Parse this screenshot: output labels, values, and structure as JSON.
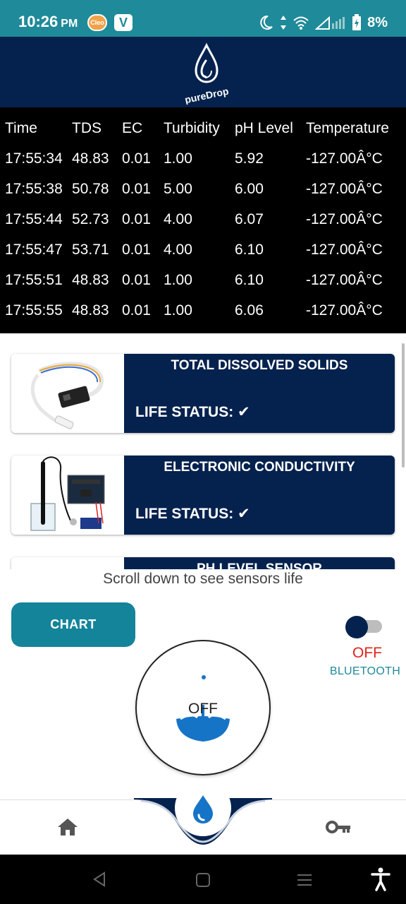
{
  "status_bar": {
    "time": "10:26",
    "ampm": "PM",
    "battery": "8%",
    "app_icon_1": "cleo-app-icon",
    "app_icon_2": "v-app-icon"
  },
  "header": {
    "logo_text": "pureDrop"
  },
  "table": {
    "headers": [
      "Time",
      "TDS",
      "EC",
      "Turbidity",
      "pH Level",
      "Temperature"
    ],
    "rows": [
      [
        "17:55:34",
        "48.83",
        "0.01",
        "1.00",
        "5.92",
        "-127.00Â°C"
      ],
      [
        "17:55:38",
        "50.78",
        "0.01",
        "5.00",
        "6.00",
        "-127.00Â°C"
      ],
      [
        "17:55:44",
        "52.73",
        "0.01",
        "4.00",
        "6.07",
        "-127.00Â°C"
      ],
      [
        "17:55:47",
        "53.71",
        "0.01",
        "4.00",
        "6.10",
        "-127.00Â°C"
      ],
      [
        "17:55:51",
        "48.83",
        "0.01",
        "1.00",
        "6.10",
        "-127.00Â°C"
      ],
      [
        "17:55:55",
        "48.83",
        "0.01",
        "1.00",
        "6.06",
        "-127.00Â°C"
      ]
    ]
  },
  "sensors": [
    {
      "title": "TOTAL DISSOLVED SOLIDS",
      "status": "LIFE STATUS: ✔"
    },
    {
      "title": "ELECTRONIC CONDUCTIVITY",
      "status": "LIFE STATUS: ✔"
    },
    {
      "title": "PH LEVEL SENSOR",
      "status": ""
    }
  ],
  "hint": "Scroll down to see sensors life",
  "chart_button": "CHART",
  "bluetooth": {
    "state": "OFF",
    "label": "BLUETOOTH"
  },
  "power": {
    "label": "OFF"
  },
  "colors": {
    "navy": "#05224e",
    "teal": "#14849a",
    "status_bar": "#1f8a99",
    "off_red": "#e0231b"
  }
}
